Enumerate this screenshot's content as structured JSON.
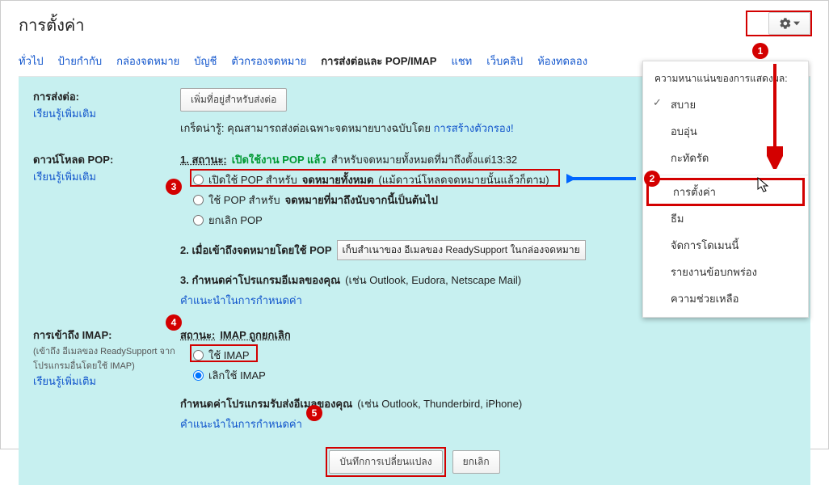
{
  "title": "การตั้งค่า",
  "tabs": [
    "ทั่วไป",
    "ป้ายกำกับ",
    "กล่องจดหมาย",
    "บัญชี",
    "ตัวกรองจดหมาย",
    "การส่งต่อและ POP/IMAP",
    "แชท",
    "เว็บคลิป",
    "ห้องทดลอง"
  ],
  "active_tab_index": 5,
  "forwarding": {
    "heading": "การส่งต่อ:",
    "learn_more": "เรียนรู้เพิ่มเติม",
    "add_button": "เพิ่มที่อยู่สำหรับส่งต่อ",
    "hint_prefix": "เกร็ดน่ารู้: คุณสามารถส่งต่อเฉพาะจดหมายบางฉบับโดย ",
    "hint_link": "การสร้างตัวกรอง!"
  },
  "pop": {
    "heading": "ดาวน์โหลด POP:",
    "learn_more": "เรียนรู้เพิ่มเติม",
    "status_label": "1. สถานะ:",
    "status_value": "เปิดใช้งาน POP แล้ว",
    "status_tail": "สำหรับจดหมายทั้งหมดที่มาถึงตั้งแต่13:32",
    "opt1_pre": "เปิดใช้ POP สำหรับ ",
    "opt1_bold": "จดหมายทั้งหมด",
    "opt1_tail": " (แม้ดาวน์โหลดจดหมายนั้นแล้วก็ตาม)",
    "opt2_pre": "ใช้ POP สำหรับ ",
    "opt2_bold": "จดหมายที่มาถึงนับจากนี้เป็นต้นไป",
    "opt3": "ยกเลิก POP",
    "step2_label": "2. เมื่อเข้าถึงจดหมายโดยใช้ POP",
    "step2_select": "เก็บสำเนาของ อีเมลของ ReadySupport ในกล่องจดหมาย",
    "step3_label": "3. กำหนดค่าโปรแกรมอีเมลของคุณ",
    "step3_tail": " (เช่น Outlook, Eudora, Netscape Mail)",
    "config_link": "คำแนะนำในการกำหนดค่า"
  },
  "imap": {
    "heading": "การเข้าถึง IMAP:",
    "subnote": "(เข้าถึง อีเมลของ ReadySupport จากโปรแกรมอื่นโดยใช้ IMAP)",
    "learn_more": "เรียนรู้เพิ่มเติม",
    "status_label": "สถานะ:",
    "status_value": "IMAP ถูกยกเลิก",
    "opt1": "ใช้ IMAP",
    "opt2": "เลิกใช้ IMAP",
    "config_label": "กำหนดค่าโปรแกรมรับส่งอีเมลของคุณ",
    "config_tail": " (เช่น Outlook, Thunderbird, iPhone)",
    "config_link": "คำแนะนำในการกำหนดค่า"
  },
  "footer": {
    "save": "บันทึกการเปลี่ยนแปลง",
    "cancel": "ยกเลิก"
  },
  "dropdown": {
    "header": "ความหนาแน่นของการแสดงผล:",
    "density": [
      "สบาย",
      "อบอุ่น",
      "กะทัดรัด"
    ],
    "items": [
      "การตั้งค่า",
      "ธีม",
      "จัดการโดเมนนี้",
      "รายงานข้อบกพร่อง",
      "ความช่วยเหลือ"
    ]
  },
  "badges": [
    "1",
    "2",
    "3",
    "4",
    "5"
  ]
}
